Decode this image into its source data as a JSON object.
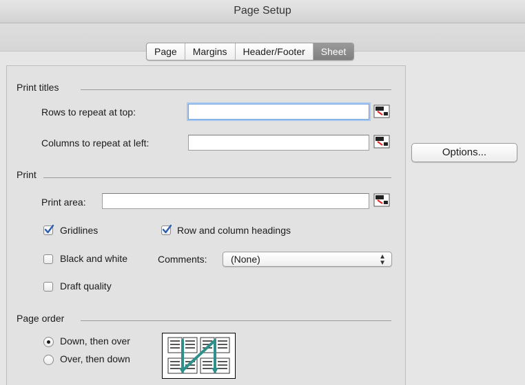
{
  "window": {
    "title": "Page Setup"
  },
  "tabs": [
    {
      "label": "Page",
      "selected": false
    },
    {
      "label": "Margins",
      "selected": false
    },
    {
      "label": "Header/Footer",
      "selected": false
    },
    {
      "label": "Sheet",
      "selected": true
    }
  ],
  "print_titles": {
    "heading": "Print titles",
    "rows_label": "Rows to repeat at top:",
    "rows_value": "",
    "columns_label": "Columns to repeat at left:",
    "columns_value": ""
  },
  "print": {
    "heading": "Print",
    "area_label": "Print area:",
    "area_value": "",
    "gridlines_label": "Gridlines",
    "gridlines_checked": true,
    "headings_label": "Row and column headings",
    "headings_checked": true,
    "bw_label": "Black and white",
    "bw_checked": false,
    "comments_label": "Comments:",
    "comments_value": "(None)",
    "draft_label": "Draft quality",
    "draft_checked": false
  },
  "page_order": {
    "heading": "Page order",
    "down_over_label": "Down, then over",
    "over_down_label": "Over, then down",
    "selected": "down_over"
  },
  "options_label": "Options...",
  "icons": {
    "ref_picker": "range-select-icon",
    "check": "checkmark-icon",
    "select_arrows": "updown-arrows-icon",
    "order_preview": "page-order-preview-icon"
  },
  "colors": {
    "focus": "#6ea2e3",
    "checkmark": "#2a5db0",
    "order_arrow": "#2f8f8a",
    "selected_tab": "#8a8a8a"
  }
}
